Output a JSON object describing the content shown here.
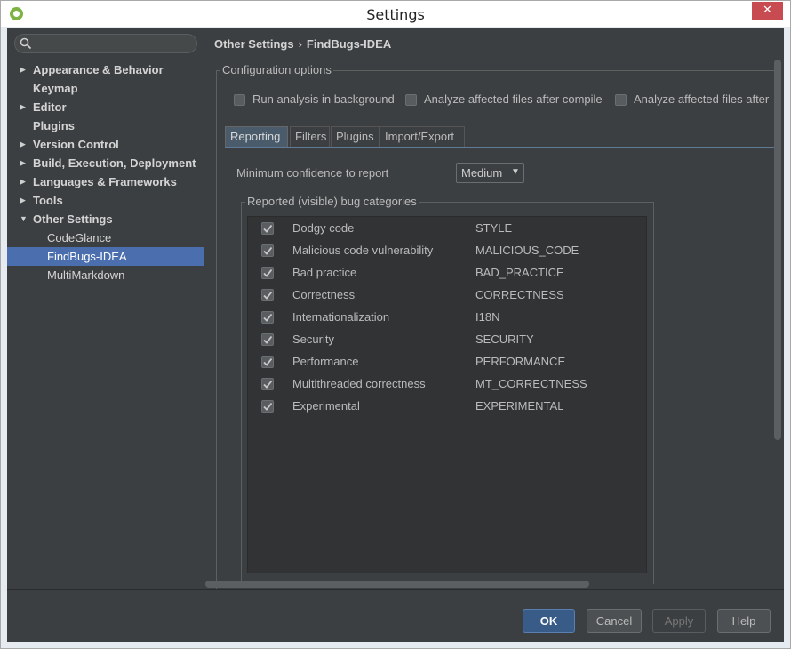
{
  "window": {
    "title": "Settings",
    "close_glyph": "✕"
  },
  "sidebar": {
    "search": {
      "placeholder": ""
    },
    "items": [
      {
        "label": "Appearance & Behavior",
        "expandable": true,
        "expanded": false
      },
      {
        "label": "Keymap",
        "expandable": false
      },
      {
        "label": "Editor",
        "expandable": true,
        "expanded": false
      },
      {
        "label": "Plugins",
        "expandable": false
      },
      {
        "label": "Version Control",
        "expandable": true,
        "expanded": false
      },
      {
        "label": "Build, Execution, Deployment",
        "expandable": true,
        "expanded": false
      },
      {
        "label": "Languages & Frameworks",
        "expandable": true,
        "expanded": false
      },
      {
        "label": "Tools",
        "expandable": true,
        "expanded": false
      },
      {
        "label": "Other Settings",
        "expandable": true,
        "expanded": true
      }
    ],
    "children": [
      {
        "label": "CodeGlance",
        "selected": false
      },
      {
        "label": "FindBugs-IDEA",
        "selected": true
      },
      {
        "label": "MultiMarkdown",
        "selected": false
      }
    ]
  },
  "breadcrumb": {
    "parent": "Other Settings",
    "separator": "›",
    "current": "FindBugs-IDEA"
  },
  "config": {
    "legend": "Configuration options",
    "options": [
      {
        "label": "Run analysis in background",
        "checked": false
      },
      {
        "label": "Analyze affected files after compile",
        "checked": false
      },
      {
        "label": "Analyze affected files after",
        "checked": false
      }
    ],
    "tabs": [
      "Reporting",
      "Filters",
      "Plugins",
      "Import/Export"
    ],
    "active_tab": "Reporting",
    "confidence_label": "Minimum confidence to report",
    "confidence_value": "Medium",
    "categories_legend": "Reported (visible) bug categories",
    "categories": [
      {
        "name": "Dodgy code",
        "code": "STYLE",
        "checked": true
      },
      {
        "name": "Malicious code vulnerability",
        "code": "MALICIOUS_CODE",
        "checked": true
      },
      {
        "name": "Bad practice",
        "code": "BAD_PRACTICE",
        "checked": true
      },
      {
        "name": "Correctness",
        "code": "CORRECTNESS",
        "checked": true
      },
      {
        "name": "Internationalization",
        "code": "I18N",
        "checked": true
      },
      {
        "name": "Security",
        "code": "SECURITY",
        "checked": true
      },
      {
        "name": "Performance",
        "code": "PERFORMANCE",
        "checked": true
      },
      {
        "name": "Multithreaded correctness",
        "code": "MT_CORRECTNESS",
        "checked": true
      },
      {
        "name": "Experimental",
        "code": "EXPERIMENTAL",
        "checked": true
      }
    ]
  },
  "buttons": {
    "ok": "OK",
    "cancel": "Cancel",
    "apply": "Apply",
    "help": "Help",
    "apply_enabled": false
  },
  "colors": {
    "selection": "#4b6eaf",
    "panel": "#3c3f41",
    "ok_button": "#385b88"
  }
}
